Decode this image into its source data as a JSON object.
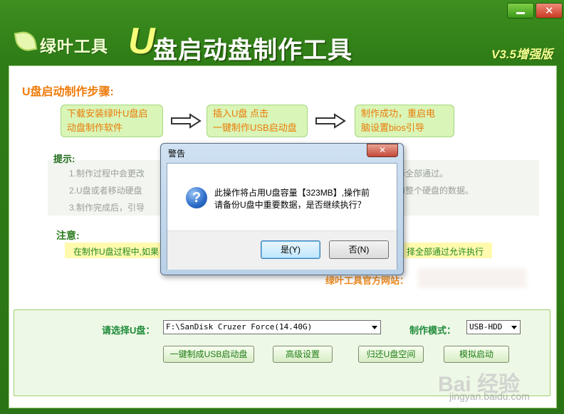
{
  "app": {
    "logo_text": "绿叶工具",
    "title_u": "U",
    "title_main": "盘启动盘制作工具",
    "version": "V3.5增强版",
    "min_label": "",
    "close_label": "✕"
  },
  "steps": {
    "heading": "U盘启动制作步骤:",
    "items": [
      {
        "line1": "下载安装绿叶U盘启",
        "line2": "动盘制作软件"
      },
      {
        "line1": "插入U盘 点击",
        "line2": "一键制作USB启动盘"
      },
      {
        "line1": "制作成功，重启电",
        "line2": "脑设置bios引导"
      }
    ]
  },
  "tips": {
    "heading": "提示:",
    "lines": [
      "1.制作过程中会更改",
      "2.U盘或者移动硬盘",
      "3.制作完成后，引导"
    ],
    "line1_right": "择全部通过。",
    "line2_right": "的整个硬盘的数据。"
  },
  "note": {
    "heading": "注意:",
    "text_left": "在制作U盘过程中,如果",
    "text_right": "择全部通过允许执行"
  },
  "website": {
    "label": "绿叶工具官方网站："
  },
  "panel": {
    "select_label": "请选择U盘：",
    "select_value": "F:\\SanDisk Cruzer Force(14.40G)",
    "mode_label": "制作模式：",
    "mode_value": "USB-HDD",
    "buttons": [
      "一键制成USB启动盘",
      "高级设置",
      "归还U盘空间",
      "模拟启动"
    ]
  },
  "dialog": {
    "title": "警告",
    "close": "✕",
    "icon": "?",
    "message_line1": "此操作将占用U盘容量【323MB】,操作前",
    "message_line2": "请备份U盘中重要数据，是否继续执行？",
    "yes_label": "是(Y)",
    "no_label": "否(N)"
  },
  "watermark": {
    "logo": "Bai 经验",
    "url": "jingyan.baidu.com"
  },
  "colors": {
    "brand_green": "#2f7d17",
    "step_text": "#ea7b07",
    "arrow_red": "#e8302a"
  }
}
